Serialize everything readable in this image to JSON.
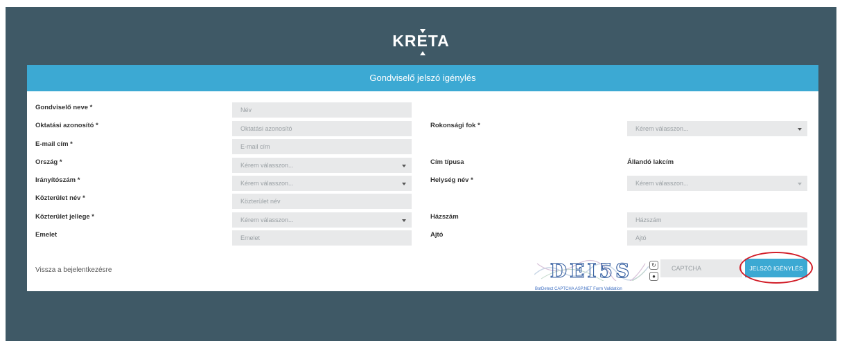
{
  "brand": {
    "logo_text": "KRETA"
  },
  "form": {
    "title": "Gondviselő jelszó igénylés",
    "fields": {
      "guardian_name": {
        "label": "Gondviselő neve *",
        "placeholder": "Név"
      },
      "edu_id": {
        "label": "Oktatási azonosító *",
        "placeholder": "Oktatási azonosító"
      },
      "email": {
        "label": "E-mail cím *",
        "placeholder": "E-mail cím"
      },
      "country": {
        "label": "Ország *",
        "value": "Kérem válasszon..."
      },
      "zip": {
        "label": "Irányítószám *",
        "value": "Kérem válasszon..."
      },
      "street_name": {
        "label": "Közterület név *",
        "placeholder": "Közterület név"
      },
      "street_type": {
        "label": "Közterület jellege *",
        "value": "Kérem válasszon..."
      },
      "floor": {
        "label": "Emelet",
        "placeholder": "Emelet"
      },
      "relation": {
        "label": "Rokonsági fok *",
        "value": "Kérem válasszon..."
      },
      "address_type": {
        "label": "Cím típusa",
        "value": "Állandó lakcím"
      },
      "city": {
        "label": "Helység név *",
        "value": "Kérem válasszon..."
      },
      "house_no": {
        "label": "Házszám",
        "placeholder": "Házszám"
      },
      "door": {
        "label": "Ajtó",
        "placeholder": "Ajtó"
      }
    },
    "back_link": "Vissza a bejelentkezésre",
    "captcha": {
      "image_text": "DEI5S",
      "footer": "BotDetect CAPTCHA ASP.NET Form Validation",
      "placeholder": "CAPTCHA"
    },
    "submit_label": "JELSZÓ IGÉNYLÉS"
  },
  "colors": {
    "background": "#3f5966",
    "accent": "#3ca9d3",
    "highlight": "#d21f2a"
  }
}
